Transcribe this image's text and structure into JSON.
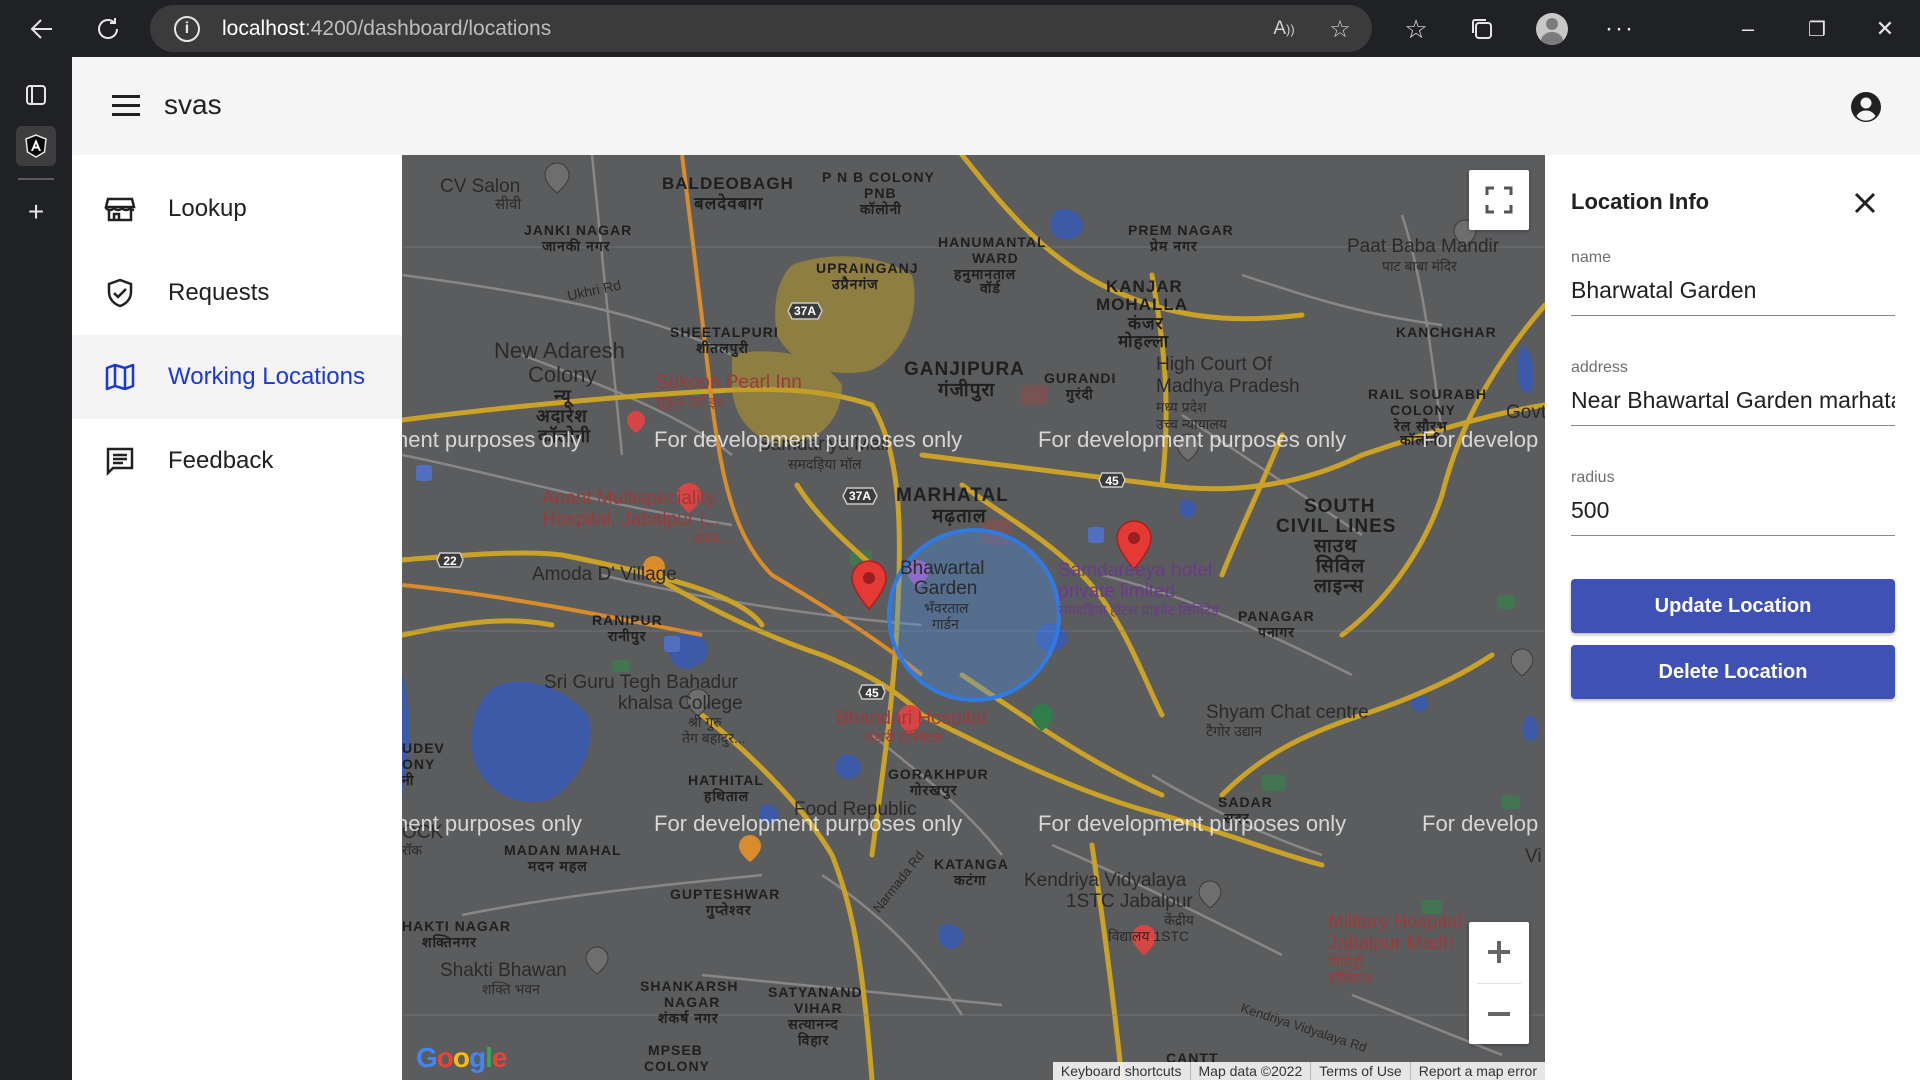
{
  "browser": {
    "url_host": "localhost",
    "url_path": ":4200/dashboard/locations",
    "icons": [
      "back-icon",
      "refresh-icon",
      "info-icon",
      "read-aloud-icon",
      "add-favorite-icon",
      "favorites-icon",
      "collections-icon",
      "profile-icon",
      "more-icon",
      "minimize-icon",
      "restore-icon",
      "close-icon"
    ]
  },
  "app": {
    "brand": "svas"
  },
  "nav": {
    "items": [
      {
        "label": "Lookup"
      },
      {
        "label": "Requests"
      },
      {
        "label": "Working Locations"
      },
      {
        "label": "Feedback"
      }
    ]
  },
  "map": {
    "dev_text": "For development purposes only",
    "dev_text_left": "nent purposes only",
    "dev_text_right": "For develop",
    "labels": {
      "cv_salon": "CV Salon",
      "cv_salon_hi": "सीवी",
      "baldeobagh": "BALDEOBAGH",
      "baldeobagh_hi": "बलदेवबाग",
      "pnb_colony": "P N B COLONY",
      "pnb": "PNB",
      "pnb_hi": "कॉलोनी",
      "janki_nagar": "JANKI NAGAR",
      "janki_nagar_hi": "जानकी नगर",
      "uprainganj": "UPRAINGANJ",
      "uprainganj_hi": "उप्रैनगंज",
      "hanumantal": "HANUMANTAL",
      "ward": "WARD",
      "hanumantal_hi": "हनुमानताल",
      "ward_hi": "वॉर्ड",
      "prem_nagar": "PREM NAGAR",
      "prem_nagar_hi": "प्रेम नगर",
      "paat_baba": "Paat Baba Mandir",
      "paat_baba_hi": "पाट बाबा मंदिर",
      "ukhri_rd": "Ukhri Rd",
      "kanjar": "KANJAR",
      "mohalla": "MOHALLA",
      "kanjar_hi": "कंजर",
      "mohalla_hi": "मोहल्ला",
      "kanchghar": "KANCHGHAR",
      "new_adaresh": "New Adaresh",
      "colony": "Colony",
      "new_adaresh_hi1": "न्यू",
      "new_adaresh_hi2": "अदारेश",
      "new_adaresh_hi3": "कॉलोनी",
      "sheetalpuri": "SHEETALPURI",
      "sheetalpuri_hi": "शीतलपुरी",
      "ganjipura": "GANJIPURA",
      "ganjipura_hi": "गंजीपुरा",
      "guradi": "GURANDI",
      "guradi_hi": "गुरंदी",
      "high_court": "High Court Of",
      "madhya_pradesh": "Madhya Pradesh",
      "high_court_hi1": "मध्य प्रदेश",
      "high_court_hi2": "उच्च न्यायालय",
      "rail_sourabh": "RAIL SOURABH",
      "rail_colony": "COLONY",
      "rail_sourabh_hi": "रेल सौरभ",
      "rail_sourabh_hi2": "कॉलोनी",
      "govt": "Govt",
      "sukoon": "Sukoon Pearl Inn",
      "sukoon_hi": "सुकून पर्ल इन",
      "samdariya_mall": "Samdariya Mall",
      "samdariya_mall_hi": "समदड़िया मॉल",
      "anant1": "Anant Multispeciality",
      "anant2": "Hospital, Jabalpur |...",
      "anant_hi": "अनंत...",
      "marhatal": "MARHATAL",
      "marhatal_hi": "मढ़ताल",
      "south1": "SOUTH",
      "south2": "CIVIL LINES",
      "south_hi1": "साउथ",
      "south_hi2": "सिविल",
      "south_hi3": "लाइन्स",
      "amoda": "Amoda D' Village",
      "bhawartal": "Bhawartal",
      "garden_short": "Garden",
      "bhawartal_hi": "भँवरताल",
      "garden_hi": "गार्डन",
      "samdareeya1": "Samdareeya hotel",
      "samdareeya2": "private limited",
      "samdareeya_hi": "समदड़िया होटल प्राइवेट लिमिटेड",
      "panagar": "PANAGAR",
      "panagar_hi": "पनागर",
      "ranipur": "RANIPUR",
      "ranipur_hi": "रानीपुर",
      "sri_guru1": "Sri Guru Tegh Bahadur",
      "sri_guru2": "khalsa College",
      "sri_guru_hi1": "श्री गुरु",
      "sri_guru_hi2": "तेग बहादुर...",
      "bhandari": "Bhandari Hospital",
      "bhandari_hi": "भंडारी हॉस्पिटल",
      "shyam": "Shyam Chat centre",
      "shyam_hi": "टैगोर उद्यान",
      "udev": "UDEV",
      "ony": "ONY",
      "ni": "नी",
      "hathital": "HATHITAL",
      "hathital_hi": "हथिताल",
      "gorakhpur": "GORAKHPUR",
      "gorakhpur_hi": "गोरखपुर",
      "sadar": "SADAR",
      "sadar_hi": "सदर",
      "food_republic": "Food Republic",
      "madan_mahal": "MADAN MAHAL",
      "madan_mahal_hi": "मदन महल",
      "ock": "OCK",
      "rock_hi": "रॉक",
      "vi": "Vi",
      "gupteshwar": "GUPTESHWAR",
      "gupteshwar_hi": "गुप्तेश्वर",
      "narmada_rd": "Narmada Rd",
      "katanga": "KATANGA",
      "katanga_hi": "कटंगा",
      "kendriya1": "Kendriya Vidyalaya",
      "kendriya2": "1STC Jabalpur",
      "kendriya_hi1": "केंद्रीय",
      "kendriya_hi2": "विद्यालय 1STC",
      "shakti_nagar": "HAKTI NAGAR",
      "shakti_nagar_hi": "शक्तिनगर",
      "military1": "Military Hospital",
      "military2": "Jabalpur Madh",
      "military_hi1": "मिलिट्री",
      "military_hi2": "हॉस्पिटल",
      "shakti_bhawan": "Shakti Bhawan",
      "shakti_bhawan_hi": "शक्ति भवन",
      "shankarsh": "SHANKARSH",
      "shankarsh_nagar": "NAGAR",
      "shankarsh_hi": "शंकर्ष नगर",
      "satyanand": "SATYANAND",
      "satyanand_vihar": "VIHAR",
      "satyanand_hi1": "सत्यानन्द",
      "satyanand_hi2": "विहार",
      "mpseb": "MPSEB",
      "mpseb_colony": "COLONY",
      "kendriya_rd": "Kendriya Vidyalaya Rd",
      "cantt": "CANTT",
      "route_37a": "37A",
      "route_37a_2": "37A",
      "route_45": "45",
      "route_45_2": "45",
      "route_22": "22"
    },
    "google": "Google",
    "attribution": [
      "Keyboard shortcuts",
      "Map data ©2022",
      "Terms of Use",
      "Report a map error"
    ],
    "circle_color": "#4a8fe8",
    "marker_color": "#e53935"
  },
  "panel": {
    "title": "Location Info",
    "name_label": "name",
    "name_value": "Bharwatal Garden",
    "address_label": "address",
    "address_value": "Near Bhawartal Garden marhatal",
    "radius_label": "radius",
    "radius_value": "500",
    "update_button": "Update Location",
    "delete_button": "Delete Location",
    "accent": "#3f51b5"
  }
}
